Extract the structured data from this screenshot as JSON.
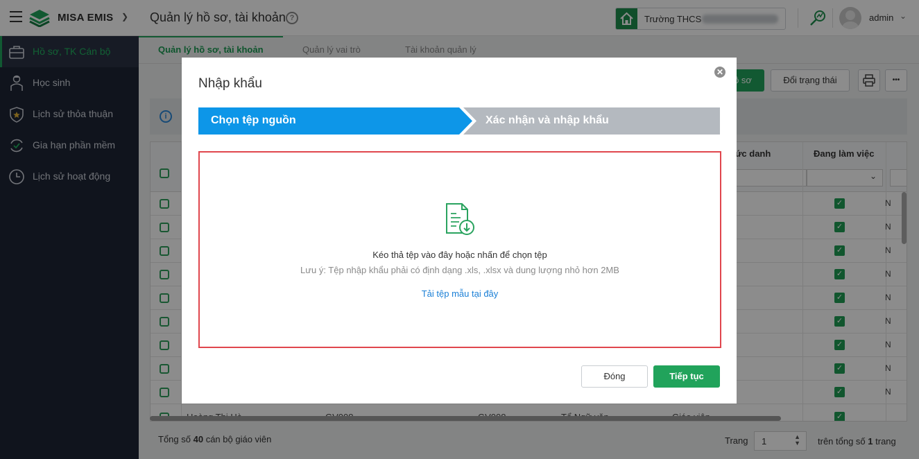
{
  "header": {
    "app_name": "MISA EMIS",
    "page_title": "Quản lý hồ sơ, tài khoản",
    "school_label": "Trường THCS",
    "user_name": "admin"
  },
  "sidebar": {
    "items": [
      {
        "label": "Hồ sơ, TK Cán bộ",
        "icon": "briefcase-icon",
        "active": true
      },
      {
        "label": "Học sinh",
        "icon": "student-icon"
      },
      {
        "label": "Lịch sử thỏa thuận",
        "icon": "shield-star-icon"
      },
      {
        "label": "Gia hạn phần mềm",
        "icon": "renew-icon"
      },
      {
        "label": "Lịch sử hoạt động",
        "icon": "clock-icon"
      }
    ]
  },
  "tabs": [
    {
      "label": "Quản lý hồ sơ, tài khoản",
      "active": true
    },
    {
      "label": "Quản lý vai trò"
    },
    {
      "label": "Tài khoản quản lý"
    }
  ],
  "toolbar": {
    "add_profile_label": "ồ sơ",
    "change_status_label": "Đổi trạng thái",
    "more_label": "•••"
  },
  "grid": {
    "col_title": "ức danh",
    "col_working": "Đang làm việc",
    "row_tail_text": "N",
    "last_row": {
      "name": "Hoàng Thị Hà",
      "code1": "GV008",
      "code2": "GV008",
      "group": "Tổ Ngữ văn",
      "role": "Giáo viên"
    }
  },
  "footer": {
    "total_prefix": "Tổng số",
    "total_count": "40",
    "total_suffix": "cán bộ giáo viên",
    "page_label": "Trang",
    "page_value": "1",
    "of_prefix": "trên tổng số",
    "of_count": "1",
    "of_suffix": "trang"
  },
  "modal": {
    "title": "Nhập khẩu",
    "close_symbol": "✕",
    "steps": [
      "Chọn tệp nguồn",
      "Xác nhận và nhập khẩu"
    ],
    "dropzone_main": "Kéo thả tệp vào đây hoặc nhấn để chọn tệp",
    "dropzone_note": "Lưu ý: Tệp nhập khẩu phải có định dạng .xls, .xlsx và dung lượng nhỏ hơn 2MB",
    "template_link": "Tải tệp mẫu tại đây",
    "close_button": "Đóng",
    "continue_button": "Tiếp tục"
  },
  "colors": {
    "brand_green": "#21a35b",
    "step_active": "#0d96e8",
    "step_inactive": "#b4b9bf",
    "dropzone_border": "#e0464d",
    "link": "#1a7fd6",
    "sidebar_bg": "#1e2535"
  }
}
